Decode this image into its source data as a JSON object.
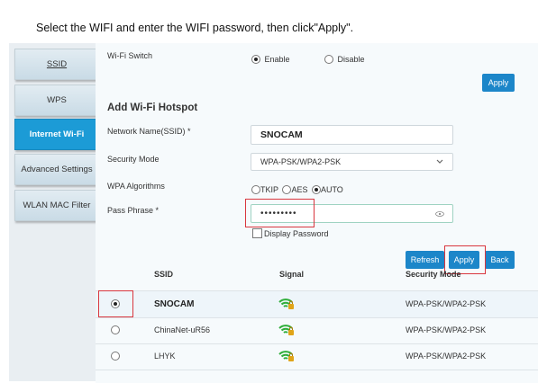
{
  "instruction": "Select the WIFI and enter the WIFI password, then click\"Apply\".",
  "sidebar": {
    "items": [
      {
        "label": "SSID"
      },
      {
        "label": "WPS"
      },
      {
        "label": "Internet Wi-Fi"
      },
      {
        "label": "Advanced Settings"
      },
      {
        "label": "WLAN MAC Filter"
      }
    ]
  },
  "wifi_switch": {
    "label": "Wi-Fi Switch",
    "enable_label": "Enable",
    "disable_label": "Disable",
    "selected": "Enable"
  },
  "top_apply_label": "Apply",
  "hotspot": {
    "title": "Add Wi-Fi Hotspot",
    "ssid_label": "Network Name(SSID) *",
    "ssid_value": "SNOCAM",
    "security_label": "Security Mode",
    "security_value": "WPA-PSK/WPA2-PSK",
    "algorithms_label": "WPA Algorithms",
    "algorithms": [
      "TKIP",
      "AES",
      "AUTO"
    ],
    "algorithm_selected": "AUTO",
    "pass_label": "Pass Phrase *",
    "pass_value": "•••••••••",
    "display_password_label": "Display Password"
  },
  "actions": {
    "refresh": "Refresh",
    "apply": "Apply",
    "back": "Back"
  },
  "table": {
    "headers": {
      "ssid": "SSID",
      "signal": "Signal",
      "security": "Security Mode"
    },
    "rows": [
      {
        "ssid": "SNOCAM",
        "security": "WPA-PSK/WPA2-PSK",
        "selected": true
      },
      {
        "ssid": "ChinaNet-uR56",
        "security": "WPA-PSK/WPA2-PSK",
        "selected": false
      },
      {
        "ssid": "LHYK",
        "security": "WPA-PSK/WPA2-PSK",
        "selected": false
      }
    ]
  },
  "icons": {
    "wifi": "wifi-lock-icon",
    "eye": "eye-icon",
    "dropdown": "chevron-down-icon"
  },
  "colors": {
    "accent": "#1c86c9",
    "active_tab": "#1c9bd6",
    "highlight": "#d9363e",
    "wifi_green": "#2fae3a",
    "lock_gold": "#e0a418"
  }
}
